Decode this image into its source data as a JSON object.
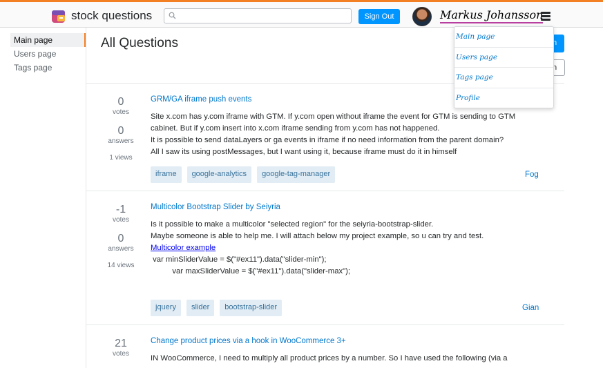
{
  "header": {
    "app_title": "stock questions",
    "search_placeholder": "",
    "sign_out_label": "Sign Out",
    "username": "Markus Johansson"
  },
  "sidebar": {
    "items": [
      {
        "label": "Main page"
      },
      {
        "label": "Users page"
      },
      {
        "label": "Tags page"
      }
    ]
  },
  "main": {
    "heading": "All Questions",
    "ask_button_label": "n",
    "filter_button_label": "n"
  },
  "dropdown": {
    "items": [
      {
        "label": "Main page"
      },
      {
        "label": "Users page"
      },
      {
        "label": "Tags page"
      },
      {
        "label": "Profile"
      }
    ]
  },
  "questions": [
    {
      "votes": "0",
      "votes_label": "votes",
      "answers": "0",
      "answers_label": "answers",
      "views": "1 views",
      "title": "GRM/GA iframe push events",
      "body": [
        "Site x.com has y.com iframe with GTM. If y.com open without iframe the event for GTM is sending to GTM",
        "cabinet. But if y.com insert into x.com iframe sending from y.com has not happened.",
        "It is possible to send dataLayers or ga events in iframe if no need information from the parent domain?",
        "All I saw its using postMessages, but I want using it, because iframe must do it in himself"
      ],
      "tags": [
        "iframe",
        "google-analytics",
        "google-tag-manager"
      ],
      "author": "Fog"
    },
    {
      "votes": "-1",
      "votes_label": "votes",
      "answers": "0",
      "answers_label": "answers",
      "views": "14 views",
      "title": "Multicolor Bootstrap Slider by Seiyria",
      "body": [
        "Is it possible to make a multicolor \"selected region\" for the seiyria-bootstrap-slider.",
        "Maybe someone is able to help me. I will attach below my project example, so u can try and test."
      ],
      "link": "Multicolor example",
      "code": [
        " var minSliderValue = $(\"#ex11\").data(\"slider-min\");",
        "          var maxSliderValue = $(\"#ex11\").data(\"slider-max\");"
      ],
      "tags": [
        "jquery",
        "slider",
        "bootstrap-slider"
      ],
      "author": "Gian"
    },
    {
      "votes": "21",
      "votes_label": "votes",
      "title": "Change product prices via a hook in WooCommerce 3+",
      "body": [
        "IN WooCommerce, I need to multiply all product prices by a number. So I have used the following (via a"
      ]
    }
  ],
  "colors": {
    "accent": "#f48024",
    "primary": "#0095ff",
    "link": "#0077cc",
    "tag_bg": "#e1ecf4",
    "tag_text": "#39739d"
  }
}
